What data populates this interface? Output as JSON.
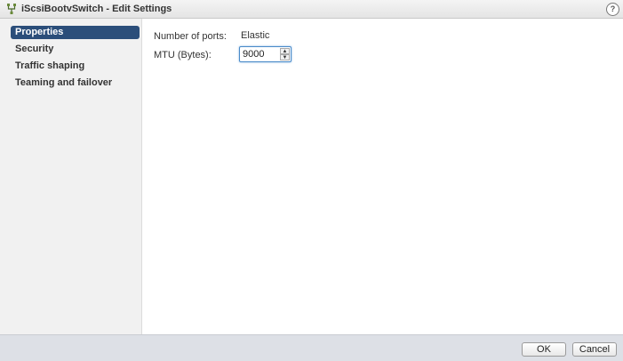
{
  "window": {
    "title": "iScsiBootvSwitch - Edit Settings",
    "icon": "switch-icon",
    "help_glyph": "?"
  },
  "sidebar": {
    "items": [
      {
        "label": "Properties",
        "selected": true
      },
      {
        "label": "Security",
        "selected": false
      },
      {
        "label": "Traffic shaping",
        "selected": false
      },
      {
        "label": "Teaming and failover",
        "selected": false
      }
    ]
  },
  "properties": {
    "ports_label": "Number of ports:",
    "ports_value": "Elastic",
    "mtu_label": "MTU (Bytes):",
    "mtu_value": "9000"
  },
  "footer": {
    "ok_label": "OK",
    "cancel_label": "Cancel"
  },
  "colors": {
    "selected_bg": "#2b4e7a",
    "sidebar_bg": "#f1f1f1",
    "footer_bg": "#dde0e6",
    "focus_border": "#4a8bc9"
  }
}
